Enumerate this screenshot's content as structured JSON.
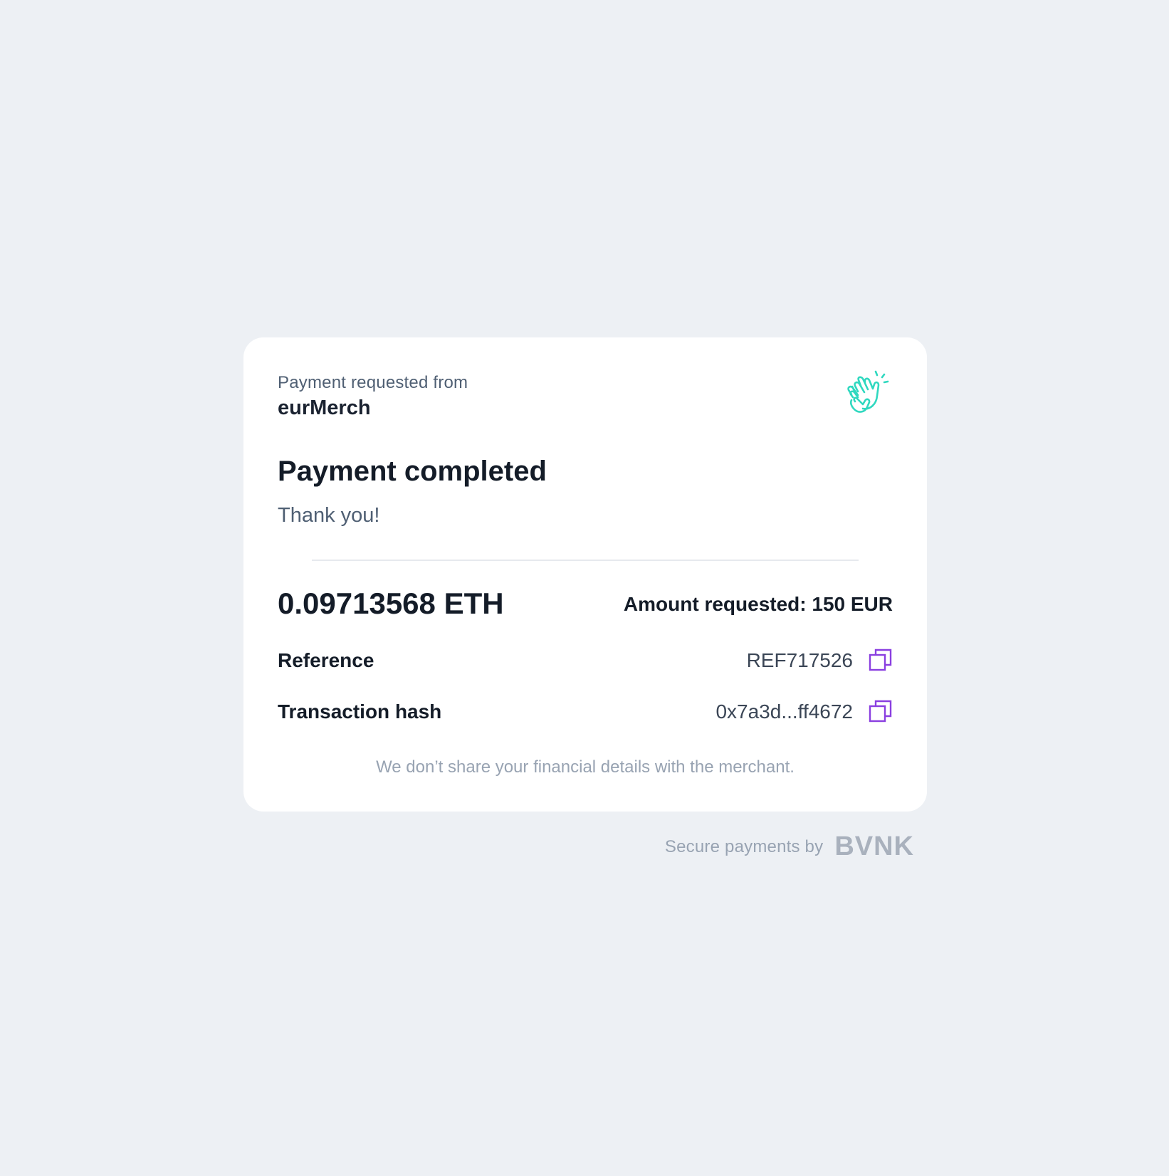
{
  "header": {
    "requested_from_label": "Payment requested from",
    "merchant_name": "eurMerch"
  },
  "status": {
    "title": "Payment completed",
    "message": "Thank you!",
    "icon": "clapping-hands-icon"
  },
  "payment": {
    "amount": "0.09713568 ETH",
    "amount_requested": "Amount requested: 150 EUR"
  },
  "details": {
    "reference_label": "Reference",
    "reference_value": "REF717526",
    "tx_hash_label": "Transaction hash",
    "tx_hash_value": "0x7a3d...ff4672"
  },
  "privacy_note": "We don’t share your financial details with the merchant.",
  "footer": {
    "text": "Secure payments by",
    "brand": "BVNK"
  },
  "colors": {
    "background": "#edf0f4",
    "card": "#ffffff",
    "accent_teal": "#2fd8bf",
    "copy_icon_purple": "#8a3fe0"
  }
}
